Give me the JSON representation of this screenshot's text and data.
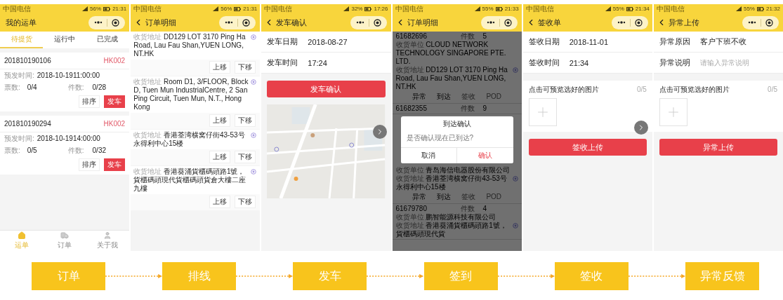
{
  "phones": [
    {
      "kind": "waybills",
      "status": {
        "carrier": "中国电信",
        "battery": "56%",
        "time": "21:31"
      },
      "header": {
        "title": "我的运单",
        "back": false
      },
      "tabs": [
        {
          "label": "待提货",
          "selected": true
        },
        {
          "label": "运行中",
          "selected": false
        },
        {
          "label": "已完成",
          "selected": false
        }
      ],
      "orders": [
        {
          "number": "201810190106",
          "code": "HK002",
          "time_label": "预发时间:",
          "time": "2018-10-1911:00:00",
          "tickets_label": "票数:",
          "tickets": "0/4",
          "pieces_label": "件数:",
          "pieces": "0/28",
          "actions": [
            {
              "label": "排序",
              "kind": "plain"
            },
            {
              "label": "发车",
              "kind": "primary"
            }
          ]
        },
        {
          "number": "201810190294",
          "code": "HK002",
          "time_label": "预发时间:",
          "time": "2018-10-1914:00:00",
          "tickets_label": "票数:",
          "tickets": "0/5",
          "pieces_label": "件数:",
          "pieces": "0/32",
          "actions": [
            {
              "label": "排序",
              "kind": "plain"
            },
            {
              "label": "发车",
              "kind": "primary"
            }
          ]
        }
      ],
      "bottom_nav": [
        {
          "label": "运单",
          "selected": true
        },
        {
          "label": "订单",
          "selected": false
        },
        {
          "label": "关于我",
          "selected": false
        }
      ]
    },
    {
      "kind": "order_detail",
      "status": {
        "carrier": "中国电信",
        "battery": "56%",
        "time": "21:31"
      },
      "header": {
        "title": "订单明细",
        "back": true
      },
      "addresses": [
        {
          "label": "收货地址",
          "text": "DD129 LOT 3170 Ping Ha Road, Lau Fau Shan,YUEN LONG, NT.HK",
          "actions": [
            "上移",
            "下移"
          ]
        },
        {
          "label": "收货地址",
          "text": "Room D1, 3/FLOOR, Block D, Tuen Mun IndustrialCentre, 2 San Ping Circuit, Tuen Mun, N.T., Hong Kong",
          "actions": [
            "上移",
            "下移"
          ]
        },
        {
          "label": "收货地址",
          "text": "香港荃湾横窝仔街43-53号永得利中心15楼",
          "actions": [
            "上移",
            "下移"
          ]
        },
        {
          "label": "收货地址",
          "text": "香港葵涌貨櫃碼頭路1號，貨櫃碼頭現代貨櫃碼頭貨倉大樓二座九樓",
          "actions": [
            "上移",
            "下移"
          ]
        }
      ]
    },
    {
      "kind": "depart",
      "status": {
        "carrier": "中国电信",
        "battery": "32%",
        "time": "17:26"
      },
      "header": {
        "title": "发车确认",
        "back": true
      },
      "fields": [
        {
          "kind": "text",
          "label": "发车日期",
          "value": "2018-08-27"
        },
        {
          "kind": "text",
          "label": "发车时间",
          "value": "17:24"
        }
      ],
      "button": "发车确认"
    },
    {
      "kind": "arrival",
      "status": {
        "carrier": "中国电信",
        "battery": "55%",
        "time": "21:33"
      },
      "header": {
        "title": "订单明细",
        "back": true
      },
      "items": [
        {
          "number": "61682696",
          "count_label": "件数",
          "count": "5",
          "unit_label": "收货单位",
          "unit": "CLOUD NETWORK TECHNOLOGY SINGAPORE PTE. LTD.",
          "address_label": "收货地址",
          "address": "DD129 LOT 3170 Ping Ha Road, Lau Fau Shan,YUEN LONG, NT.HK",
          "actions": [
            {
              "label": "异常",
              "disabled": false
            },
            {
              "label": "到达",
              "disabled": false
            },
            {
              "label": "签收",
              "disabled": true
            },
            {
              "label": "POD",
              "disabled": true
            }
          ]
        },
        {
          "number": "61682355",
          "count_label": "件数",
          "count": "9"
        }
      ],
      "dialog": {
        "title": "到达确认",
        "message": "是否确认现在已到达?",
        "cancel": "取消",
        "confirm": "确认"
      },
      "items_after": [
        {
          "unit_label": "收货单位",
          "unit": "青岛海信电器股份有限公司",
          "address_label": "收货地址",
          "address": "香港荃湾横窝仔街43-53号永得利中心15楼",
          "actions": [
            {
              "label": "异常",
              "disabled": false
            },
            {
              "label": "到达",
              "disabled": false
            },
            {
              "label": "签收",
              "disabled": true
            },
            {
              "label": "POD",
              "disabled": true
            }
          ]
        },
        {
          "number": "61679780",
          "count_label": "件数",
          "count": "4",
          "unit_label": "收货单位",
          "unit": "鹏智能源科技有限公司",
          "address_label": "收货地址",
          "address": "香港葵涌貨櫃碼頭路1號，貨櫃碼頭現代貨"
        }
      ]
    },
    {
      "kind": "sign",
      "status": {
        "carrier": "中国电信",
        "battery": "55%",
        "time": "21:34"
      },
      "header": {
        "title": "签收单",
        "back": true
      },
      "fields": [
        {
          "kind": "text",
          "label": "签收日期",
          "value": "2018-11-01"
        },
        {
          "kind": "text",
          "label": "签收时间",
          "value": "21:34"
        }
      ],
      "photos": {
        "title": "点击可预览选好的图片",
        "count": "0/5"
      },
      "button": "签收上传"
    },
    {
      "kind": "exception",
      "status": {
        "carrier": "中国电信",
        "battery": "55%",
        "time": "21:32"
      },
      "header": {
        "title": "异常上传",
        "back": true
      },
      "fields": [
        {
          "kind": "text",
          "label": "异常原因",
          "value": "客户下班不收"
        },
        {
          "kind": "input",
          "label": "异常说明",
          "placeholder": "请输入异常说明"
        }
      ],
      "photos": {
        "title": "点击可预览选好的图片",
        "count": "0/5"
      },
      "button": "异常上传"
    }
  ],
  "flow": [
    "订单",
    "排线",
    "发车",
    "签到",
    "签收",
    "异常反馈"
  ]
}
